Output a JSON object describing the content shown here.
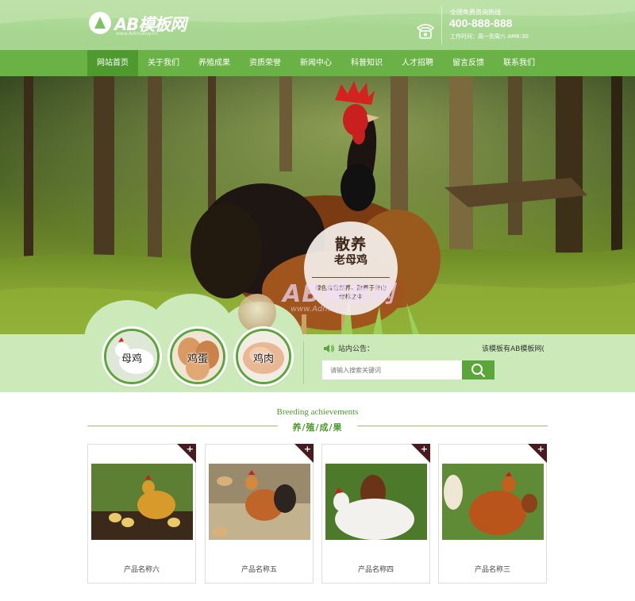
{
  "header": {
    "logo_text": "AB模板网",
    "logo_sub": "www.Admubuy.cn",
    "hotline_title": "全国免费咨询热线",
    "hotline_number": "400-888-888",
    "hotline_hours": "工作时间：周一到周六 AM8:30"
  },
  "nav": {
    "items": [
      "网站首页",
      "关于我们",
      "养殖成果",
      "资质荣誉",
      "新闻中心",
      "科普知识",
      "人才招聘",
      "留言反馈",
      "联系我们"
    ],
    "active_index": 0
  },
  "hero": {
    "badge_title": "散养",
    "badge_subtitle": "老母鸡",
    "badge_desc": "绿色食自然养，散养于青山绿林之中",
    "watermark": "AB模板网",
    "watermark_url": "www.AdminBuy.cn"
  },
  "categories": [
    "母鸡",
    "鸡蛋",
    "鸡肉"
  ],
  "notice": {
    "label": "站内公告：",
    "text": "该模板有AB模板网(",
    "search_placeholder": "请输入搜索关键词"
  },
  "section": {
    "title_en": "Breeding achievements",
    "title_cn": "养/殖/成/果"
  },
  "products": [
    {
      "name": "产品名称六"
    },
    {
      "name": "产品名称五"
    },
    {
      "name": "产品名称四"
    },
    {
      "name": "产品名称三"
    }
  ],
  "colors": {
    "brand_green": "#6ab246",
    "nav_active": "#4e9a2e",
    "band_bg": "#cbe9b9",
    "card_corner": "#4a1a20"
  },
  "icons": [
    "logo-icon",
    "phone-icon",
    "speaker-icon",
    "search-icon",
    "plus-icon"
  ]
}
